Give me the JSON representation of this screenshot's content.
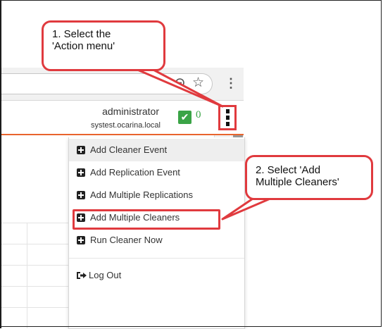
{
  "callouts": {
    "step1": "1. Select the\n'Action menu'",
    "step2": "2. Select 'Add\nMultiple Cleaners'"
  },
  "browser": {
    "zoom_icon": "zoom-out-icon",
    "bookmark_icon": "star-icon",
    "menu_icon": "vertical-dots-icon",
    "star_glyph": "☆",
    "menu_glyph": "⋮"
  },
  "header": {
    "username": "administrator",
    "hostname": "systest.ocarina.local",
    "status_check": "✔",
    "status_count": "0",
    "status_color": "#3aa446",
    "accent_color": "#e8642d"
  },
  "menu": {
    "items": [
      {
        "label": "Add Cleaner Event",
        "icon": "plus-square-icon"
      },
      {
        "label": "Add Replication Event",
        "icon": "plus-square-icon"
      },
      {
        "label": "Add Multiple Replications",
        "icon": "plus-square-icon"
      },
      {
        "label": "Add Multiple Cleaners",
        "icon": "plus-square-icon"
      },
      {
        "label": "Run Cleaner Now",
        "icon": "plus-square-icon"
      }
    ],
    "logout": {
      "label": "Log Out",
      "icon": "sign-out-icon"
    }
  },
  "annotation_color": "#e03a3e"
}
